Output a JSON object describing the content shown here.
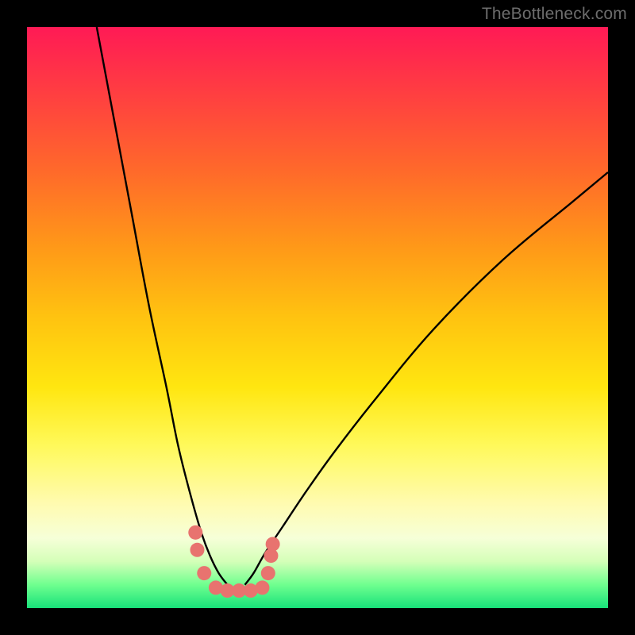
{
  "watermark": "TheBottleneck.com",
  "chart_data": {
    "type": "line",
    "title": "",
    "xlabel": "",
    "ylabel": "",
    "xlim": [
      0,
      100
    ],
    "ylim": [
      0,
      100
    ],
    "series": [
      {
        "name": "left-branch",
        "x": [
          12,
          15,
          18,
          21,
          24,
          26,
          28,
          30,
          31.5,
          33,
          34.5
        ],
        "y": [
          100,
          84,
          68,
          52,
          38,
          28,
          20,
          13,
          9,
          6,
          4
        ]
      },
      {
        "name": "right-branch",
        "x": [
          37.5,
          39,
          41,
          44,
          48,
          53,
          60,
          70,
          82,
          94,
          100
        ],
        "y": [
          4,
          6,
          9.5,
          14,
          20,
          27,
          36,
          48,
          60,
          70,
          75
        ]
      },
      {
        "name": "dot-cluster",
        "x": [
          29,
          29.3,
          30.5,
          32.5,
          34.5,
          36.5,
          38.5,
          40.5,
          41.5,
          42,
          42.3
        ],
        "y": [
          13,
          10,
          6,
          3.5,
          3,
          3,
          3,
          3.5,
          6,
          9,
          11
        ]
      }
    ],
    "colors": {
      "curve": "#000000",
      "dots": "#e8736f"
    }
  }
}
